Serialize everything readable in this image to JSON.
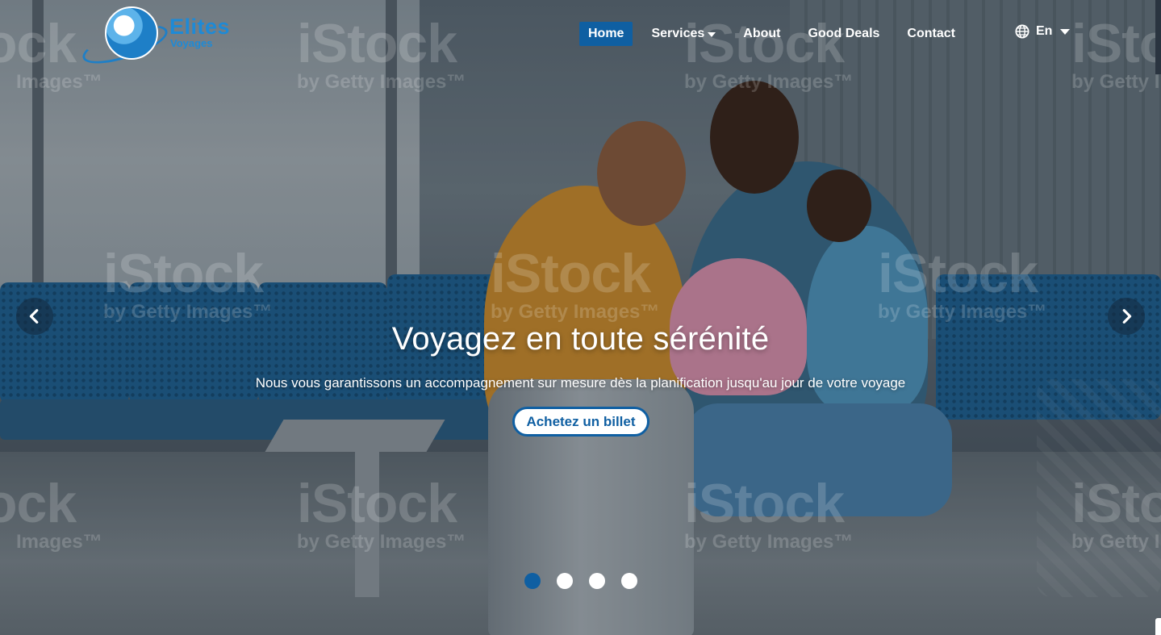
{
  "brand": {
    "name": "Elites",
    "tagline": "Voyages",
    "color": "#1e8ad6"
  },
  "nav": {
    "items": [
      {
        "label": "Home",
        "active": true
      },
      {
        "label": "Services",
        "has_dropdown": true
      },
      {
        "label": "About"
      },
      {
        "label": "Good Deals"
      },
      {
        "label": "Contact"
      }
    ],
    "active_color": "#0f5fa2"
  },
  "language": {
    "icon": "globe-icon",
    "label": "En"
  },
  "hero": {
    "title": "Voyagez en toute sérénité",
    "subtitle": "Nous vous garantissons un accompagnement sur mesure dès la planification jusqu'au jour de votre voyage",
    "cta_label": "Achetez un billet",
    "prev_icon": "chevron-left-icon",
    "next_icon": "chevron-right-icon"
  },
  "watermark": {
    "brand": "iStock",
    "line": "by Getty Images™",
    "short_line": "Images™"
  },
  "carousel": {
    "slide_count": 4,
    "active_index": 0
  }
}
